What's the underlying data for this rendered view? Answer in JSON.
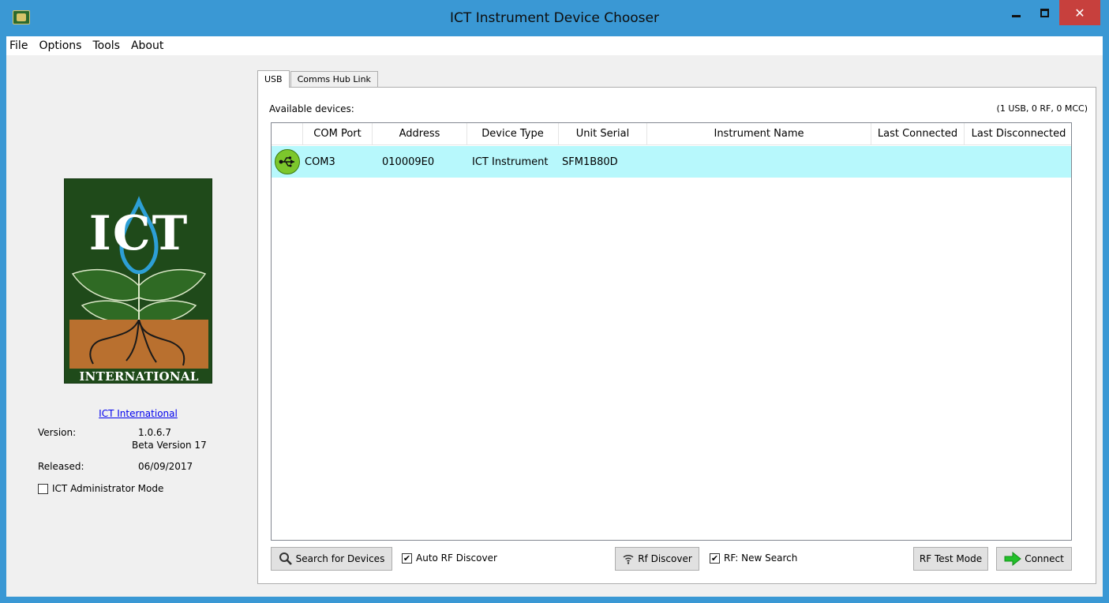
{
  "window": {
    "title": "ICT Instrument Device Chooser"
  },
  "menu": {
    "items": [
      "File",
      "Options",
      "Tools",
      "About"
    ]
  },
  "logo": {
    "text": "ICT",
    "band": "INTERNATIONAL"
  },
  "about": {
    "link": "ICT International",
    "version_label": "Version:",
    "version_value": "1.0.6.7",
    "version_beta": "Beta Version 17",
    "released_label": "Released:",
    "released_value": "06/09/2017",
    "admin_mode_label": "ICT Administrator Mode",
    "admin_mode_checked": false
  },
  "tabs": [
    {
      "label": "USB",
      "active": true
    },
    {
      "label": "Comms Hub Link",
      "active": false
    }
  ],
  "devices": {
    "label": "Available devices:",
    "count": "(1 USB, 0 RF, 0 MCC)",
    "columns": [
      "",
      "COM Port",
      "Address",
      "Device Type",
      "Unit Serial",
      "Instrument Name",
      "Last Connected",
      "Last Disconnected"
    ],
    "rows": [
      {
        "icon": "usb-icon",
        "com_port": "COM3",
        "address": "010009E0",
        "device_type": "ICT Instrument",
        "unit_serial": "SFM1B80D",
        "instrument_name": "",
        "last_connected": "",
        "last_disconnected": ""
      }
    ]
  },
  "actions": {
    "search": "Search for Devices",
    "auto_rf": "Auto RF Discover",
    "auto_rf_checked": true,
    "rf_discover": "Rf Discover",
    "rf_new_search": "RF: New Search",
    "rf_new_search_checked": true,
    "rf_test_mode": "RF Test Mode",
    "connect": "Connect"
  },
  "colors": {
    "title_bar": "#3a98d4",
    "close": "#c7403d",
    "row_highlight": "#b7f8fc",
    "logo_green": "#1f4a1a",
    "logo_soil": "#b9702f"
  }
}
